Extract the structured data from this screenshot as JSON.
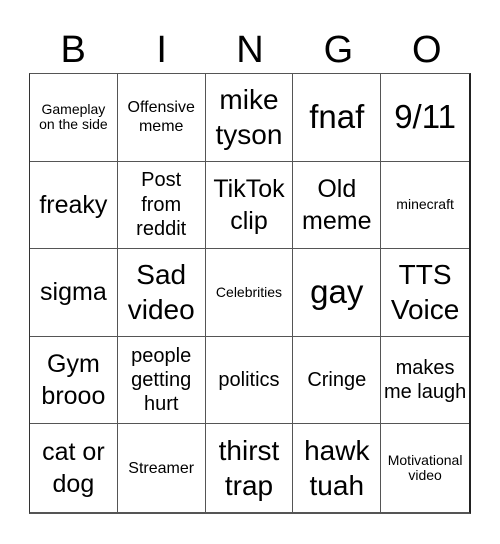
{
  "header": {
    "letters": [
      "B",
      "I",
      "N",
      "G",
      "O"
    ]
  },
  "cells": [
    {
      "text": "Gameplay on the side"
    },
    {
      "text": "Offensive meme"
    },
    {
      "text": "mike tyson"
    },
    {
      "text": "fnaf"
    },
    {
      "text": "9/11"
    },
    {
      "text": "freaky"
    },
    {
      "text": "Post from reddit"
    },
    {
      "text": "TikTok clip"
    },
    {
      "text": "Old meme"
    },
    {
      "text": "minecraft"
    },
    {
      "text": "sigma"
    },
    {
      "text": "Sad video"
    },
    {
      "text": "Celebrities"
    },
    {
      "text": "gay"
    },
    {
      "text": "TTS Voice"
    },
    {
      "text": "Gym brooo"
    },
    {
      "text": "people getting hurt"
    },
    {
      "text": "politics"
    },
    {
      "text": "Cringe"
    },
    {
      "text": "makes me laugh"
    },
    {
      "text": "cat or dog"
    },
    {
      "text": "Streamer"
    },
    {
      "text": "thirst trap"
    },
    {
      "text": "hawk tuah"
    },
    {
      "text": "Motivational video"
    }
  ]
}
